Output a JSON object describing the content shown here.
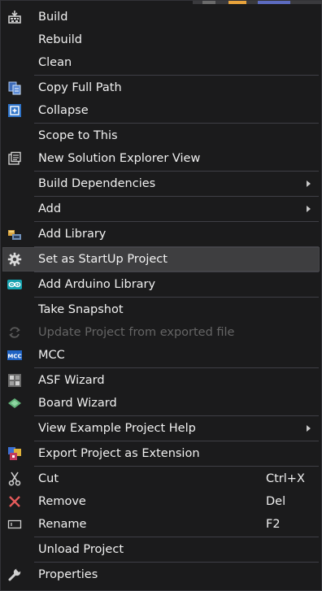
{
  "menu": {
    "build": "Build",
    "rebuild": "Rebuild",
    "clean": "Clean",
    "copy_full_path": "Copy Full Path",
    "collapse": "Collapse",
    "scope_to_this": "Scope to This",
    "new_solution_explorer_view": "New Solution Explorer View",
    "build_dependencies": "Build Dependencies",
    "add": "Add",
    "add_library": "Add Library",
    "set_as_startup_project": "Set as StartUp Project",
    "add_arduino_library": "Add Arduino Library",
    "take_snapshot": "Take Snapshot",
    "update_project": "Update Project from exported file",
    "mcc": "MCC",
    "asf_wizard": "ASF Wizard",
    "board_wizard": "Board Wizard",
    "view_example_project_help": "View Example Project Help",
    "export_project_as_extension": "Export Project as Extension",
    "cut": "Cut",
    "cut_shortcut": "Ctrl+X",
    "remove": "Remove",
    "remove_shortcut": "Del",
    "rename": "Rename",
    "rename_shortcut": "F2",
    "unload_project": "Unload Project",
    "properties": "Properties"
  },
  "icons": {
    "build": "build-icon",
    "copy_full_path": "copy-icon",
    "collapse": "collapse-icon",
    "new_solution_explorer_view": "new-window-icon",
    "add_library": "library-icon",
    "set_as_startup_project": "gear-icon",
    "add_arduino_library": "arduino-icon",
    "update_project": "refresh-icon",
    "mcc": "mcc-icon",
    "asf_wizard": "asf-wizard-icon",
    "board_wizard": "board-icon",
    "export_project_as_extension": "export-icon",
    "cut": "scissors-icon",
    "remove": "remove-icon",
    "rename": "rename-icon",
    "properties": "wrench-icon"
  },
  "colors": {
    "menu_background": "#1b1b1c",
    "hover_background": "#3e3e40",
    "text": "#f1f1f1",
    "disabled_text": "#656565",
    "separator": "#3f3f46"
  },
  "state": {
    "hovered_item": "set_as_startup_project",
    "disabled_items": [
      "update_project"
    ]
  }
}
